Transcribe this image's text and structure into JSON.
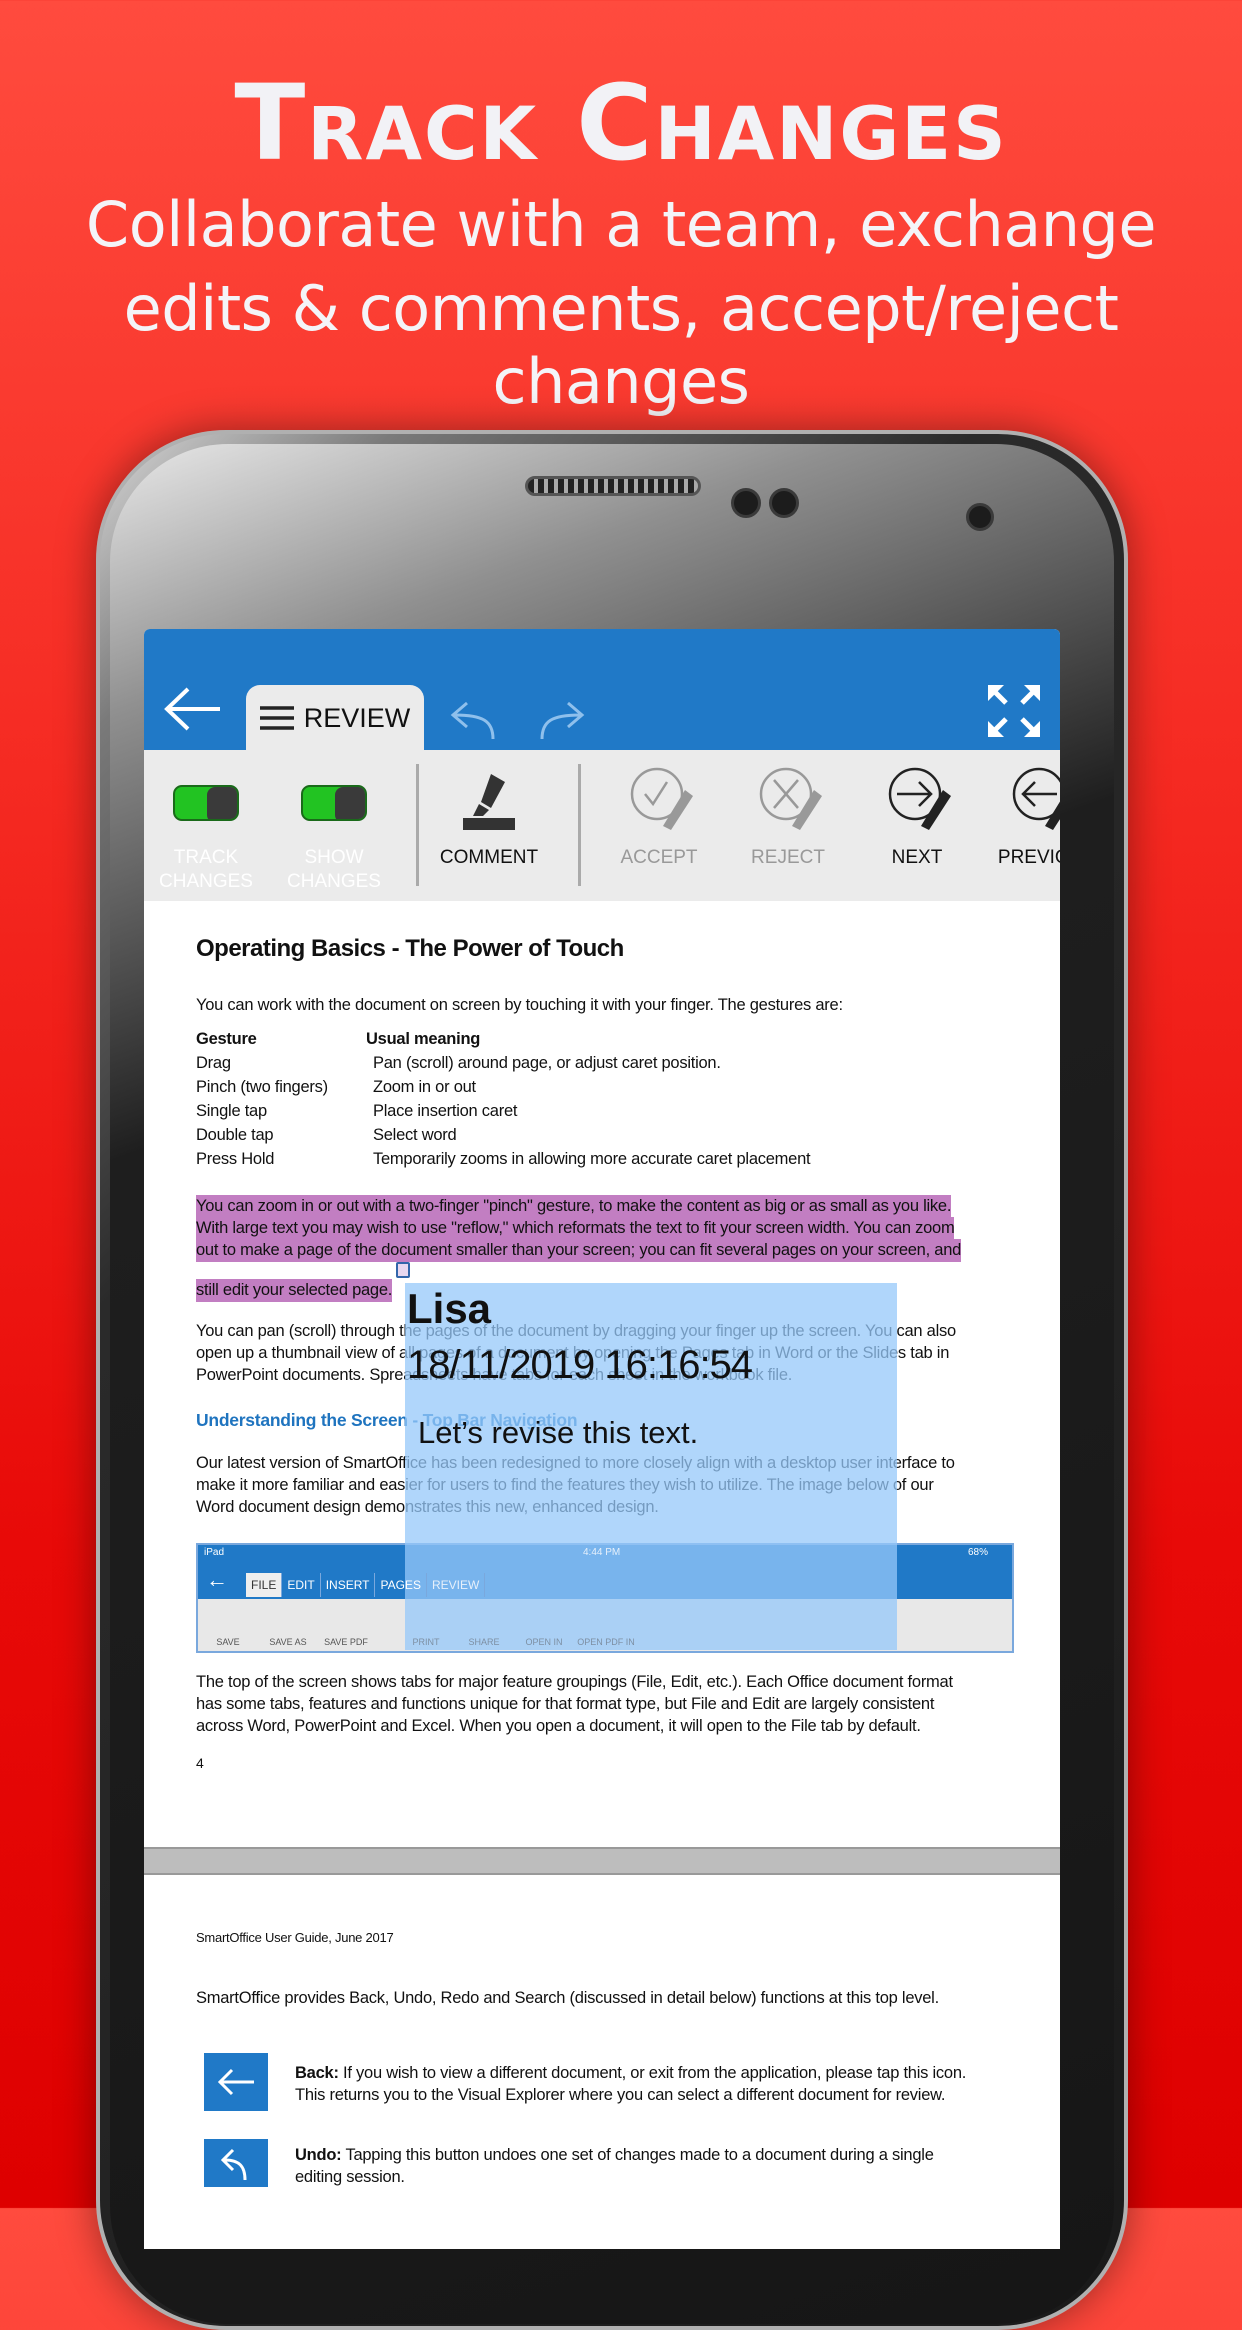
{
  "hero": {
    "title": "Track Changes",
    "subtitle_lines": [
      "Collaborate with a team, exchange",
      "edits & comments, accept/reject changes"
    ]
  },
  "app": {
    "colors": {
      "accent": "#2079c7",
      "toggle_on": "#22c322",
      "highlight": "#c27ec2",
      "comment_overlay": "#a8d0fa"
    },
    "topbar": {
      "back_icon": "arrow-left-icon",
      "tab_label": "REVIEW",
      "tab_icon": "hamburger-icon",
      "undo_icon": "undo-icon",
      "redo_icon": "redo-icon",
      "fullscreen_icon": "expand-icon"
    },
    "toolbar": {
      "track_changes": {
        "label_1": "TRACK",
        "label_2": "CHANGES",
        "on": true
      },
      "show_changes": {
        "label_1": "SHOW",
        "label_2": "CHANGES",
        "on": true
      },
      "comment": "COMMENT",
      "accept": "ACCEPT",
      "reject": "REJECT",
      "next": "NEXT",
      "previous": "PREVIOUS"
    }
  },
  "document": {
    "title": "Operating Basics - The Power of Touch",
    "intro": "You can work with the document on screen by touching it with your finger. The gestures are:",
    "table": {
      "headers": [
        "Gesture",
        "Usual meaning"
      ],
      "rows": [
        [
          "Drag",
          "Pan (scroll) around page, or adjust caret position."
        ],
        [
          "Pinch (two fingers)",
          "Zoom in or out"
        ],
        [
          "Single tap",
          "Place insertion caret"
        ],
        [
          "Double tap",
          "Select word"
        ],
        [
          "Press Hold",
          "Temporarily zooms in allowing more accurate caret placement"
        ]
      ]
    },
    "highlighted_lines": [
      "You can zoom in or out with a two-finger \"pinch\" gesture, to make the content as big or as small as you like.",
      "With large text you may wish to use \"reflow,\" which reformats the text to fit your screen width. You can zoom",
      "out to make a page of the document smaller than your screen; you can fit several pages on your screen, and",
      "still edit your selected page."
    ],
    "pan_lines": [
      "You can pan (scroll) through the pages of the document by dragging your finger up the screen. You can also",
      "open up a thumbnail view of all pages of a document by opening the Pages tab in Word or the Slides tab in",
      "PowerPoint documents. Spreadsheets have tabs for each sheet in the workbook file."
    ],
    "heading2": "Understanding the Screen - Top Bar Navigation",
    "latest_lines": [
      "Our latest version of SmartOffice has been redesigned to more closely align with a desktop user interface to",
      "make it more familiar and easier for users to find the features they wish to utilize. The image below of our",
      "Word document design demonstrates this new, enhanced design."
    ],
    "embedded": {
      "status_left": "iPad",
      "status_time": "4:44 PM",
      "status_battery": "68%",
      "tabs": [
        "FILE",
        "EDIT",
        "INSERT",
        "PAGES",
        "REVIEW"
      ],
      "buttons": [
        "SAVE",
        "SAVE AS",
        "SAVE PDF",
        "PRINT",
        "SHARE",
        "OPEN IN",
        "OPEN PDF IN"
      ]
    },
    "top_lines": [
      "The top of the screen shows tabs for major feature groupings (File, Edit, etc.). Each Office document format",
      "has some tabs, features and functions unique for that format type, but File and Edit are largely consistent",
      "across Word, PowerPoint and Excel. When you open a document, it will open to the File tab by default."
    ],
    "page_number": "4",
    "page2": {
      "header": "SmartOffice User Guide, June 2017",
      "intro": "SmartOffice provides Back, Undo, Redo and Search (discussed in detail below) functions at this top level.",
      "back": {
        "term": "Back:",
        "lines": [
          " If you wish to view a different document, or exit from the application, please tap this icon.",
          "This returns you to the Visual Explorer where you can select a different document for review."
        ]
      },
      "undo": {
        "term": "Undo:",
        "lines": [
          " Tapping this button undoes one set of changes made to a document during a single",
          "editing session."
        ]
      }
    }
  },
  "comment": {
    "author": "Lisa",
    "timestamp": "18/11/2019 16:16:54",
    "text": "Let’s revise this text."
  }
}
